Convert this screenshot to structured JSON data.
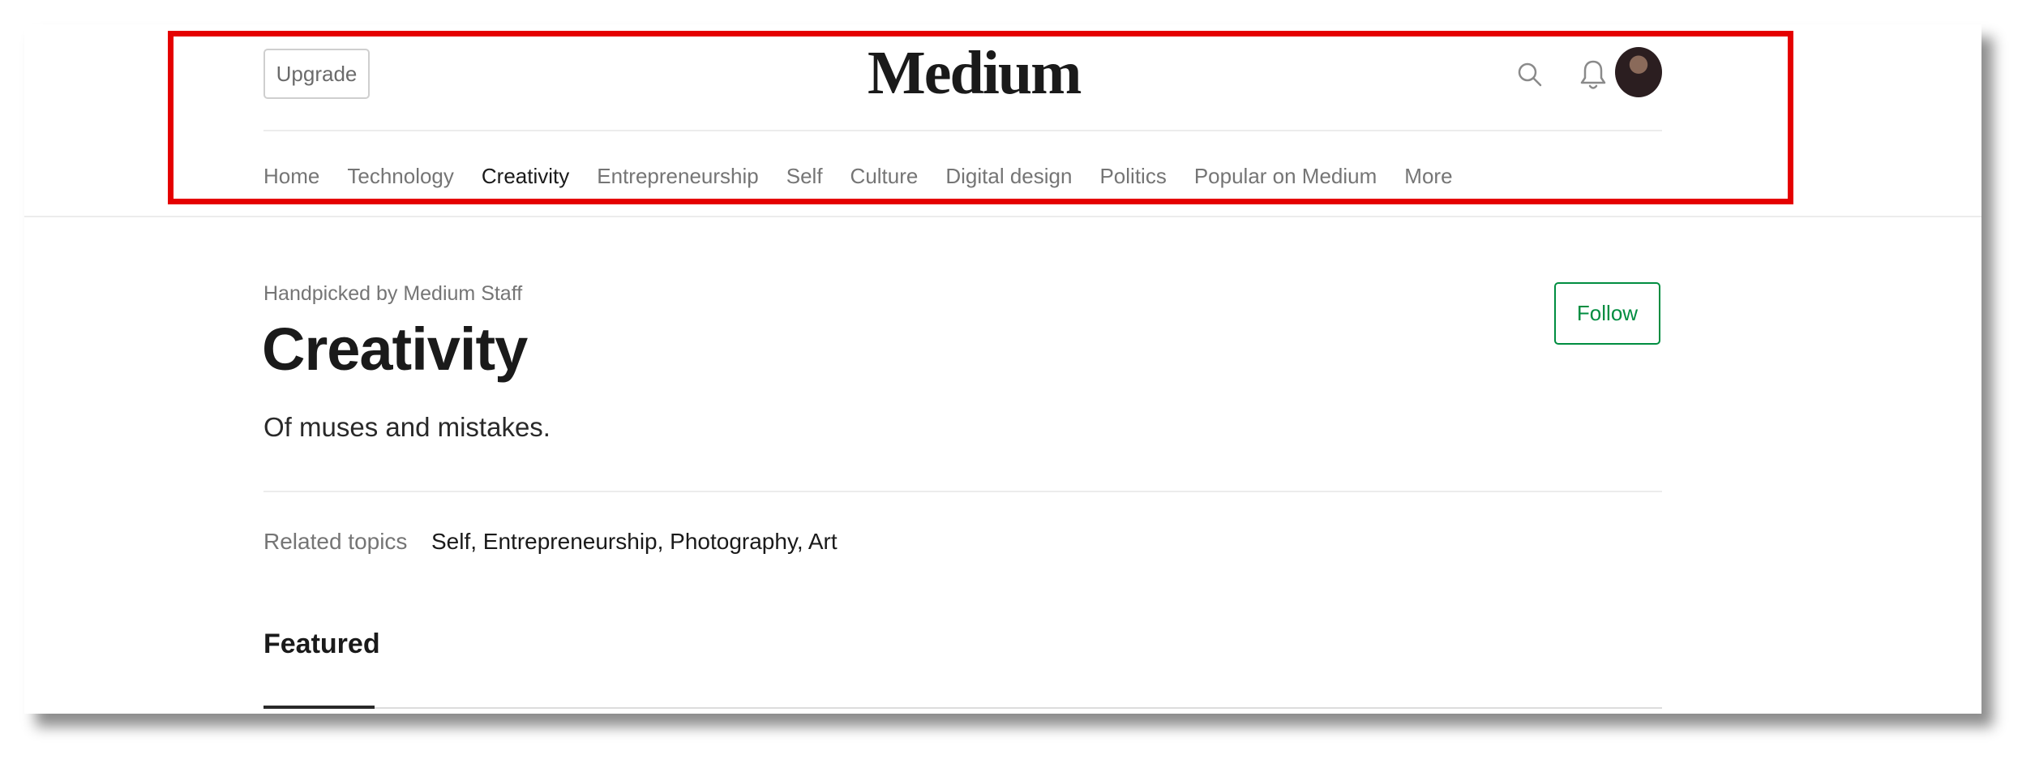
{
  "header": {
    "upgrade_label": "Upgrade",
    "logo_text": "Medium",
    "icons": {
      "search": "search-icon",
      "notifications": "bell-icon",
      "avatar": "user-avatar"
    }
  },
  "nav": {
    "items": [
      {
        "label": "Home",
        "active": false
      },
      {
        "label": "Technology",
        "active": false
      },
      {
        "label": "Creativity",
        "active": true
      },
      {
        "label": "Entrepreneurship",
        "active": false
      },
      {
        "label": "Self",
        "active": false
      },
      {
        "label": "Culture",
        "active": false
      },
      {
        "label": "Digital design",
        "active": false
      },
      {
        "label": "Politics",
        "active": false
      },
      {
        "label": "Popular on Medium",
        "active": false
      },
      {
        "label": "More",
        "active": false
      }
    ]
  },
  "topic": {
    "eyebrow": "Handpicked by Medium Staff",
    "title": "Creativity",
    "tagline": "Of muses and mistakes.",
    "follow_label": "Follow",
    "related_label": "Related topics",
    "related_topics": "Self, Entrepreneurship, Photography, Art",
    "featured_label": "Featured"
  },
  "colors": {
    "highlight_border": "#e50000",
    "follow_accent": "#03a87c"
  }
}
